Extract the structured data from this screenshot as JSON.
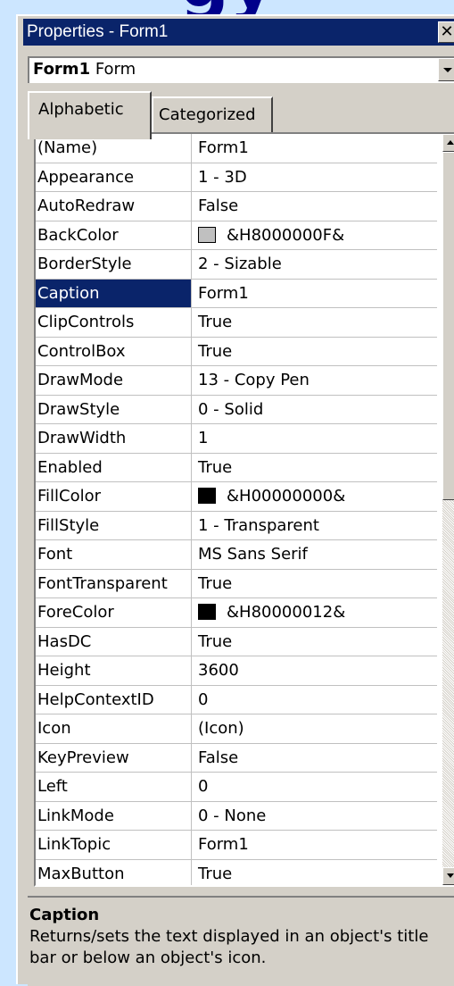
{
  "window": {
    "title": "Properties - Form1",
    "close_glyph": "✕",
    "object_name": "Form1",
    "object_type": "Form"
  },
  "tabs": [
    {
      "label": "Alphabetic",
      "selected": true
    },
    {
      "label": "Categorized",
      "selected": false
    }
  ],
  "properties": [
    {
      "name": "(Name)",
      "value": "Form1"
    },
    {
      "name": "Appearance",
      "value": "1 - 3D"
    },
    {
      "name": "AutoRedraw",
      "value": "False"
    },
    {
      "name": "BackColor",
      "value": "&H8000000F&",
      "swatch": "#c0c0c0"
    },
    {
      "name": "BorderStyle",
      "value": "2 - Sizable"
    },
    {
      "name": "Caption",
      "value": "Form1",
      "selected": true
    },
    {
      "name": "ClipControls",
      "value": "True"
    },
    {
      "name": "ControlBox",
      "value": "True"
    },
    {
      "name": "DrawMode",
      "value": "13 - Copy Pen"
    },
    {
      "name": "DrawStyle",
      "value": "0 - Solid"
    },
    {
      "name": "DrawWidth",
      "value": "1"
    },
    {
      "name": "Enabled",
      "value": "True"
    },
    {
      "name": "FillColor",
      "value": "&H00000000&",
      "swatch": "#000000"
    },
    {
      "name": "FillStyle",
      "value": "1 - Transparent"
    },
    {
      "name": "Font",
      "value": "MS Sans Serif"
    },
    {
      "name": "FontTransparent",
      "value": "True"
    },
    {
      "name": "ForeColor",
      "value": "&H80000012&",
      "swatch": "#000000"
    },
    {
      "name": "HasDC",
      "value": "True"
    },
    {
      "name": "Height",
      "value": "3600"
    },
    {
      "name": "HelpContextID",
      "value": "0"
    },
    {
      "name": "Icon",
      "value": "(Icon)"
    },
    {
      "name": "KeyPreview",
      "value": "False"
    },
    {
      "name": "Left",
      "value": "0"
    },
    {
      "name": "LinkMode",
      "value": "0 - None"
    },
    {
      "name": "LinkTopic",
      "value": "Form1"
    },
    {
      "name": "MaxButton",
      "value": "True"
    }
  ],
  "description": {
    "title": "Caption",
    "line1": "Returns/sets the text displayed in an object's title",
    "line2": "bar or below an object's icon."
  },
  "colors": {
    "titlebar": "#0a246a",
    "selection": "#0a246a",
    "background": "#cce6ff"
  }
}
